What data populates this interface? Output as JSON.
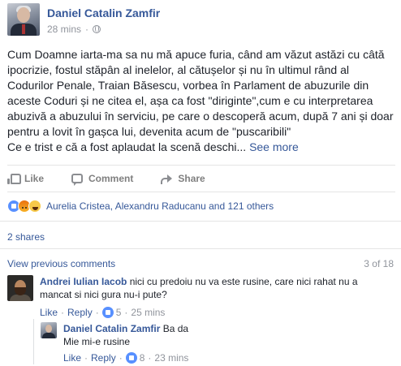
{
  "post": {
    "author": "Daniel Catalin Zamfir",
    "time": "28 mins",
    "separator": "·",
    "privacy_icon": "globe-icon",
    "body": "Cum Doamne iarta-ma sa nu mă apuce furia, când am văzut astăzi cu câtă ipocrizie, fostul stăpân al inelelor, al cătușelor și nu în ultimul rând al Codurilor Penale, Traian Băsescu, vorbea în Parlament de abuzurile din aceste Coduri și ne citea el, așa ca fost \"diriginte\",cum e cu interpretarea abuzivă a abuzului în serviciu, pe care o descoperă acum, după 7 ani și doar pentru a lovit în gașca lui, devenita acum de \"puscaribili\"\nCe e trist e că a fost aplaudat la scenă deschi...",
    "see_more": "See more"
  },
  "actions": {
    "like": "Like",
    "comment": "Comment",
    "share": "Share"
  },
  "reactions": {
    "icons": [
      "like-reaction-icon",
      "angry-reaction-icon",
      "haha-reaction-icon"
    ],
    "summary": "Aurelia Cristea, Alexandru Raducanu and 121 others"
  },
  "shares": "2 shares",
  "comments_header": {
    "view_previous": "View previous comments",
    "count": "3 of 18"
  },
  "comments": [
    {
      "author": "Andrei Iulian Iacob",
      "text": "nici cu predoiu nu va este rusine, care nici rahat nu a mancat si nici gura nu-i pute?",
      "like": "Like",
      "reply": "Reply",
      "likes": "5",
      "time": "25 mins"
    },
    {
      "author": "Daniel Catalin Zamfir",
      "text_line1": "Ba da",
      "text_line2": "Mie mi-e rusine",
      "like": "Like",
      "reply": "Reply",
      "likes": "8",
      "time": "23 mins"
    }
  ],
  "colors": {
    "link": "#365899",
    "muted": "#90949c",
    "text": "#1d2129",
    "like_blue": "#5890ff"
  }
}
